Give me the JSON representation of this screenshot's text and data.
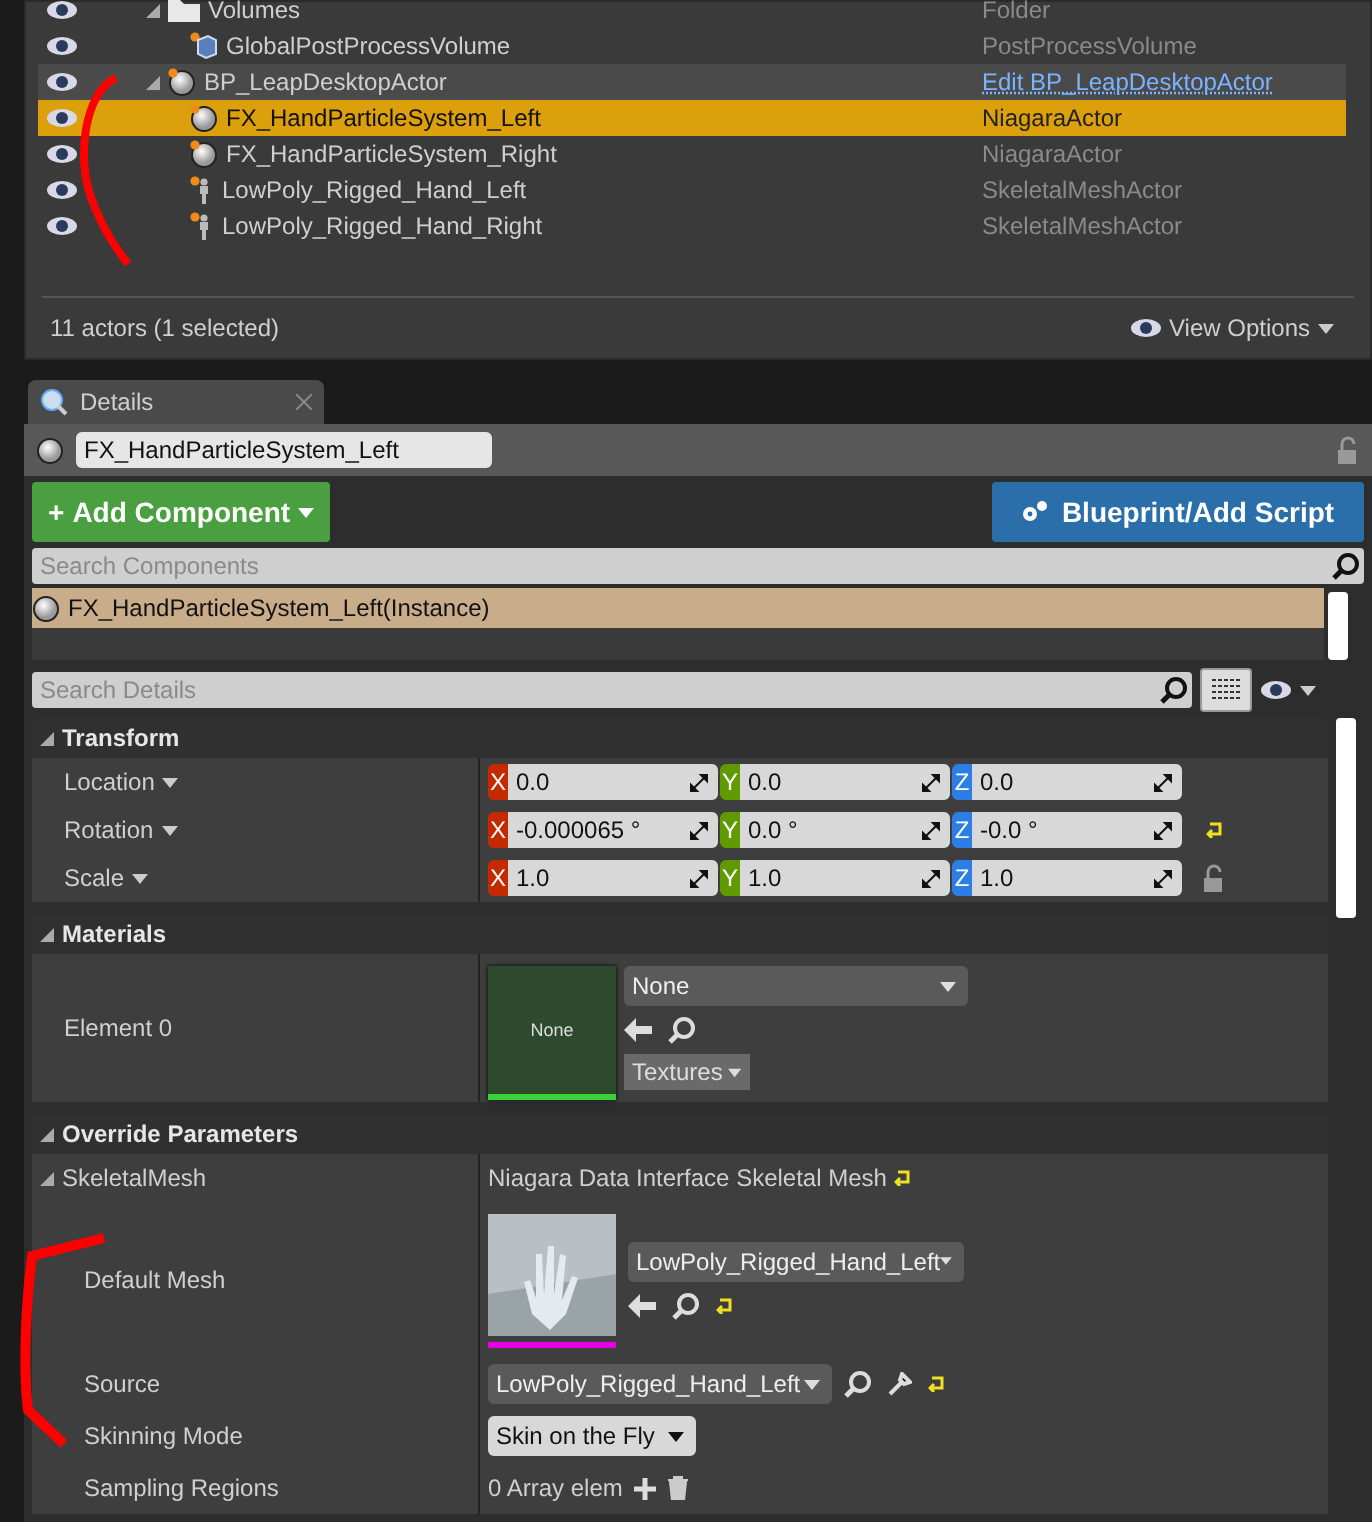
{
  "outliner": {
    "rows": [
      {
        "label": "Volumes",
        "type_label": "Folder",
        "kind": "folder",
        "link": false,
        "selected": false,
        "hovered": false,
        "expanded": true,
        "children": [
          {
            "label": "GlobalPostProcessVolume",
            "type_label": "PostProcessVolume",
            "kind": "volume",
            "link": false,
            "selected": false,
            "hovered": false
          }
        ]
      },
      {
        "label": "BP_LeapDesktopActor",
        "type_label": "Edit BP_LeapDesktopActor",
        "kind": "sphere",
        "link": true,
        "selected": false,
        "hovered": true,
        "expanded": true,
        "children": [
          {
            "label": "FX_HandParticleSystem_Left",
            "type_label": "NiagaraActor",
            "kind": "sphere",
            "link": false,
            "selected": true,
            "hovered": false
          },
          {
            "label": "FX_HandParticleSystem_Right",
            "type_label": "NiagaraActor",
            "kind": "sphere",
            "link": false,
            "selected": false,
            "hovered": false
          },
          {
            "label": "LowPoly_Rigged_Hand_Left",
            "type_label": "SkeletalMeshActor",
            "kind": "skeletal",
            "link": false,
            "selected": false,
            "hovered": false
          },
          {
            "label": "LowPoly_Rigged_Hand_Right",
            "type_label": "SkeletalMeshActor",
            "kind": "skeletal",
            "link": false,
            "selected": false,
            "hovered": false
          }
        ]
      }
    ],
    "status": "11 actors (1 selected)",
    "view_options": "View Options"
  },
  "details": {
    "tab": "Details",
    "actor_name": "FX_HandParticleSystem_Left",
    "add_component_sign": "+",
    "add_component": "Add Component",
    "blueprint": "Blueprint/Add Script",
    "search_components": {
      "placeholder": "Search Components"
    },
    "components": [
      {
        "label": "FX_HandParticleSystem_Left(Instance)",
        "selected": true
      }
    ],
    "search_details": {
      "placeholder": "Search Details"
    },
    "categories": [
      {
        "title": "Transform",
        "kind": "transform",
        "rows": [
          {
            "label": "Location",
            "resettable": false,
            "values": [
              {
                "axis": "X",
                "color": "#c42a00",
                "value": "0.0"
              },
              {
                "axis": "Y",
                "color": "#5f9b00",
                "value": "0.0"
              },
              {
                "axis": "Z",
                "color": "#2b7ee4",
                "value": "0.0"
              }
            ]
          },
          {
            "label": "Rotation",
            "resettable": true,
            "values": [
              {
                "axis": "X",
                "color": "#c42a00",
                "value": "-0.000065 °"
              },
              {
                "axis": "Y",
                "color": "#5f9b00",
                "value": "0.0 °"
              },
              {
                "axis": "Z",
                "color": "#2b7ee4",
                "value": "-0.0 °"
              }
            ]
          },
          {
            "label": "Scale",
            "resettable": false,
            "locked": false,
            "values": [
              {
                "axis": "X",
                "color": "#c42a00",
                "value": "1.0"
              },
              {
                "axis": "Y",
                "color": "#5f9b00",
                "value": "1.0"
              },
              {
                "axis": "Z",
                "color": "#2b7ee4",
                "value": "1.0"
              }
            ]
          }
        ]
      },
      {
        "title": "Materials",
        "kind": "materials",
        "rows": [
          {
            "label": "Element 0",
            "thumb_text": "None",
            "value": "None",
            "filter": "Textures"
          }
        ]
      },
      {
        "title": "Override Parameters",
        "kind": "override",
        "rows": [
          {
            "label": "SkeletalMesh",
            "value": "Niagara Data Interface Skeletal Mesh",
            "resettable": true,
            "expanded": true,
            "children": [
              {
                "kind": "asset",
                "label": "Default Mesh",
                "value": "LowPoly_Rigged_Hand_Left",
                "resettable": true
              },
              {
                "kind": "source",
                "label": "Source",
                "value": "LowPoly_Rigged_Hand_Left",
                "resettable": true
              },
              {
                "kind": "combo",
                "label": "Skinning Mode",
                "value": "Skin on the Fly"
              },
              {
                "kind": "array",
                "label": "Sampling Regions",
                "value": "0 Array elem"
              }
            ]
          }
        ]
      }
    ]
  }
}
